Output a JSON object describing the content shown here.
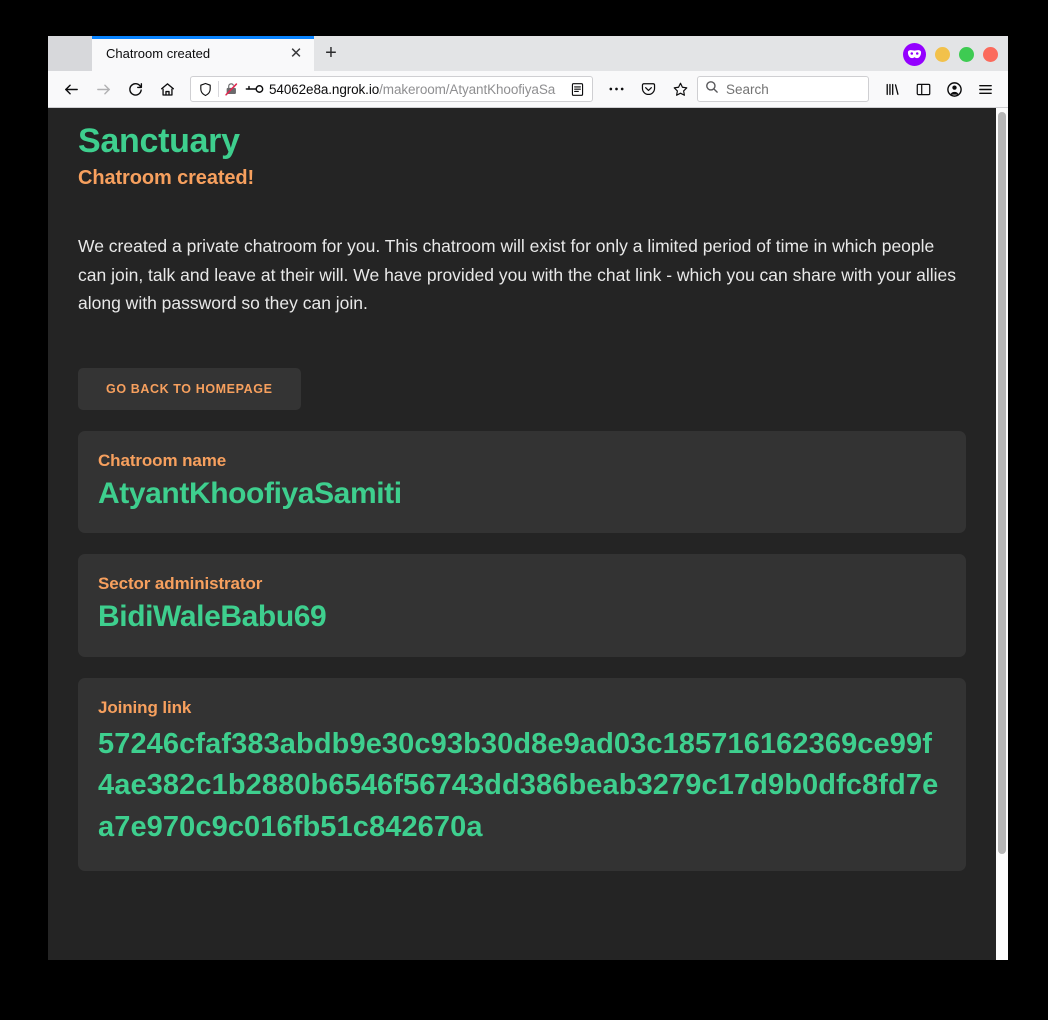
{
  "browser": {
    "tab": {
      "title": "Chatroom created",
      "close_label": "✕"
    },
    "new_tab_label": "+",
    "window_controls": {
      "container_icon": "container-mask-icon",
      "minimize_color": "#f2c14b",
      "maximize_color": "#3ecb52",
      "close_color": "#fb6a5c"
    },
    "nav": {
      "back_icon": "back-arrow-icon",
      "forward_icon": "forward-arrow-icon",
      "reload_icon": "reload-icon",
      "home_icon": "home-icon"
    },
    "urlbar": {
      "shield_icon": "tracking-protection-shield-icon",
      "insecure_icon": "insecure-connection-icon",
      "permission_icon": "saved-login-key-icon",
      "domain": "54062e8a.ngrok.io",
      "path": "/makeroom/AtyantKhoofiyaSa",
      "reader_icon": "reader-view-icon",
      "page_actions_icon": "page-actions-ellipsis-icon",
      "pocket_icon": "pocket-icon",
      "bookmark_icon": "bookmark-star-icon"
    },
    "search": {
      "icon": "search-icon",
      "placeholder": "Search",
      "value": ""
    },
    "toolbar_right": {
      "library_icon": "library-icon",
      "sidebar_icon": "sidebar-icon",
      "account_icon": "account-avatar-icon",
      "menu_icon": "hamburger-menu-icon"
    }
  },
  "page": {
    "site_title": "Sanctuary",
    "subtitle": "Chatroom created!",
    "intro": "We created a private chatroom for you. This chatroom will exist for only a limited period of time in which people can join, talk and leave at their will. We have provided you with the chat link - which you can share with your allies along with password so they can join.",
    "homepage_button": "GO BACK TO HOMEPAGE",
    "cards": [
      {
        "label": "Chatroom name",
        "value": "AtyantKhoofiyaSamiti"
      },
      {
        "label": "Sector administrator",
        "value": "BidiWaleBabu69"
      },
      {
        "label": "Joining link",
        "value": "57246cfaf383abdb9e30c93b30d8e9ad03c185716162369ce99f4ae382c1b2880b6546f56743dd386beab3279c17d9b0dfc8fd7ea7e970c9c016fb51c842670a"
      }
    ],
    "colors": {
      "background": "#242424",
      "card_background": "#333333",
      "accent_green": "#3ecf8e",
      "accent_orange": "#f7a05e",
      "body_text": "#e8e8e8"
    }
  }
}
